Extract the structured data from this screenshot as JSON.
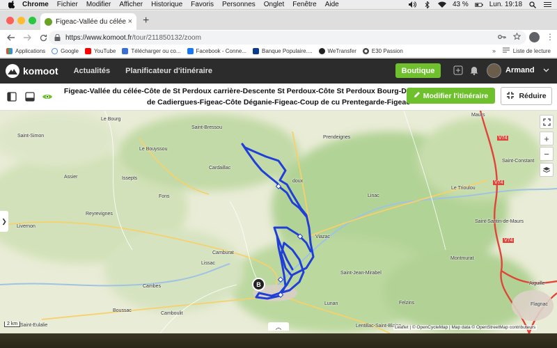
{
  "menubar": {
    "app": "Chrome",
    "items": [
      "Fichier",
      "Modifier",
      "Afficher",
      "Historique",
      "Favoris",
      "Personnes",
      "Onglet",
      "Fenêtre",
      "Aide"
    ],
    "battery": "43 %",
    "clock": "Lun. 19:18"
  },
  "tab": {
    "title": "Figeac-Vallée du célée-Côte d",
    "close": "×",
    "new_tab": "+"
  },
  "address": {
    "host": "https://www.komoot.fr",
    "path": "/tour/211850132/zoom"
  },
  "bookmarks": {
    "items": [
      {
        "label": "Applications",
        "color": "#d94f3d"
      },
      {
        "label": "Google",
        "color": "#4285f4"
      },
      {
        "label": "YouTube",
        "color": "#ff0000"
      },
      {
        "label": "Télécharger ou co...",
        "color": "#3b6fd6"
      },
      {
        "label": "Facebook - Conne...",
        "color": "#1877f2"
      },
      {
        "label": "Banque Populaire....",
        "color": "#0b3c8c"
      },
      {
        "label": "WeTransfer",
        "color": "#222222"
      },
      {
        "label": "E30 Passion",
        "color": "#444444"
      }
    ],
    "more": "»",
    "reading_list": "Liste de lecture"
  },
  "komoot": {
    "brand": "komoot",
    "nav_news": "Actualités",
    "nav_planner": "Planificateur d'itinéraire",
    "shop_button": "Boutique",
    "user_name": "Armand",
    "accent": "#6ec02d"
  },
  "tour": {
    "title": "Figeac-Vallée du célée-Côte de St Perdoux carrière-Descente St Perdoux-Côte St Perdoux Bourg-Descente St Perdoux-Côte de Cadiergues-Figeac-Côte Déganie-Figeac-Coup de cu Prentegarde-Figeac",
    "edit_button": "Modifier l'itinéraire",
    "reduce_button": "Réduire"
  },
  "map": {
    "places": [
      {
        "name": "Le Bourg"
      },
      {
        "name": "Saint-Bressou"
      },
      {
        "name": "Saint-Simon"
      },
      {
        "name": "Le Bouyssou"
      },
      {
        "name": "Prendeignes"
      },
      {
        "name": "Cardaillac"
      },
      {
        "name": "Assier"
      },
      {
        "name": "Issepts"
      },
      {
        "name": "doux"
      },
      {
        "name": "Linac"
      },
      {
        "name": "Le Trioulou"
      },
      {
        "name": "Saint-Constant"
      },
      {
        "name": "Maurs"
      },
      {
        "name": "Fons"
      },
      {
        "name": "Reyrevignes"
      },
      {
        "name": "Livernon"
      },
      {
        "name": "Viazac"
      },
      {
        "name": "Saint-Santin-de-Maurs"
      },
      {
        "name": "Camburat"
      },
      {
        "name": "Montmurat"
      },
      {
        "name": "Lissac"
      },
      {
        "name": "Saint-Jean-Mirabel"
      },
      {
        "name": "Cambes"
      },
      {
        "name": "Camboulit"
      },
      {
        "name": "Boussac"
      },
      {
        "name": "Lunan"
      },
      {
        "name": "Felzins"
      },
      {
        "name": "Flagnac"
      },
      {
        "name": "Lentillac-Saint-Blaise"
      },
      {
        "name": "Saint-Eulalie"
      },
      {
        "name": "Aiguille"
      }
    ],
    "roads": [
      "V74",
      "V74",
      "V74"
    ],
    "marker_b": "B",
    "scale": "2 km",
    "attribution": "Leaflet | © OpenCycleMap | Map data © OpenStreetMap contributeurs",
    "zoom_in": "+",
    "zoom_out": "−",
    "route_color": "#1f3fd6"
  }
}
